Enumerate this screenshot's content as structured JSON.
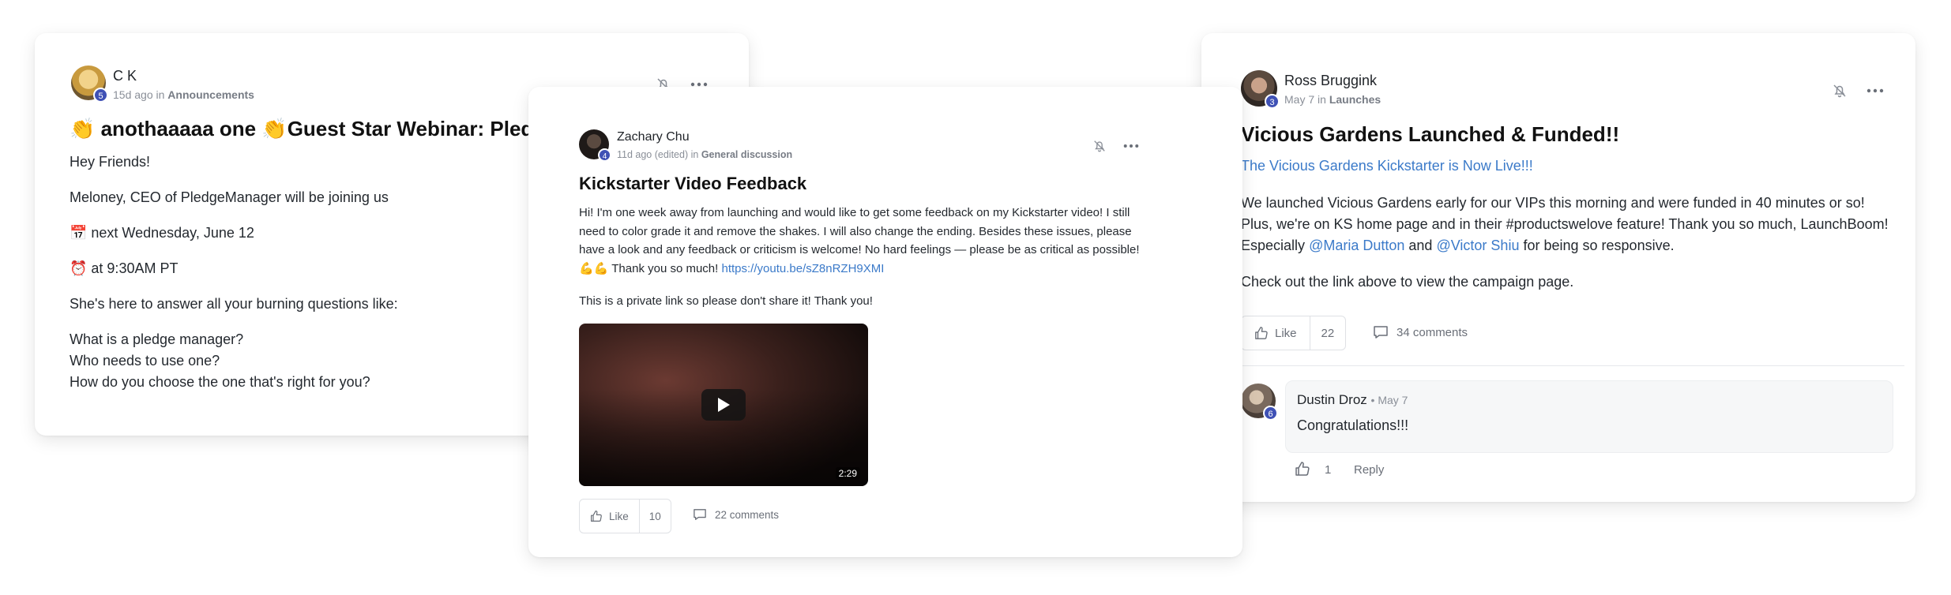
{
  "card1": {
    "author": "C K",
    "badge": "5",
    "meta_time": "15d ago in",
    "meta_space": "Announcements",
    "title": "👏 anothaaaaa one 👏Guest Star Webinar: PledgeManager",
    "paragraphs": [
      "Hey Friends!",
      "Meloney, CEO of PledgeManager will be joining us",
      "📅 next Wednesday, June 12",
      "⏰ at 9:30AM PT",
      "She's here to answer all your burning questions like:"
    ],
    "questions": [
      "What is a pledge manager?",
      "Who needs to use one?",
      "How do you choose the one that's right for you?"
    ]
  },
  "card2": {
    "author": "Zachary Chu",
    "badge": "4",
    "meta_time": "11d ago (edited) in",
    "meta_space": "General discussion",
    "title": "Kickstarter Video Feedback",
    "body": "Hi! I'm one week away from launching and would like to get some feedback on my Kickstarter video! I still need to color grade it and remove the shakes. I will also change the ending. Besides these issues, please have a look and any feedback or criticism is welcome! No hard feelings — please be as critical as possible! 💪💪 Thank you so much!",
    "link": "https://youtu.be/sZ8nRZH9XMI",
    "note": "This is a private link so please don't share it! Thank you!",
    "video_duration": "2:29",
    "like_label": "Like",
    "like_count": "10",
    "comments_label": "22 comments"
  },
  "card3": {
    "author": "Ross Bruggink",
    "badge": "3",
    "meta_time": "May 7 in",
    "meta_space": "Launches",
    "title": "Vicious Gardens Launched & Funded!!",
    "headline_link": "The Vicious Gardens Kickstarter is Now Live!!!",
    "body_part1": "We launched Vicious Gardens early for our VIPs this morning and were funded in 40 minutes or so! Plus, we're on KS home page and in their #productswelove feature! Thank you so much, LaunchBoom! Especially",
    "mention1": "@Maria Dutton",
    "body_and": "and",
    "mention2": "@Victor Shiu",
    "body_part2": "for being so responsive.",
    "body2": "Check out the link above to view the campaign page.",
    "like_label": "Like",
    "like_count": "22",
    "comments_label": "34 comments",
    "comment": {
      "author": "Dustin Droz",
      "badge": "6",
      "time": "• May 7",
      "text": "Congratulations!!!",
      "like_count": "1",
      "reply_label": "Reply"
    }
  },
  "colors": {
    "accent": "#3b7ac9",
    "badge": "#3f51b5",
    "muted": "#8a8f98"
  }
}
